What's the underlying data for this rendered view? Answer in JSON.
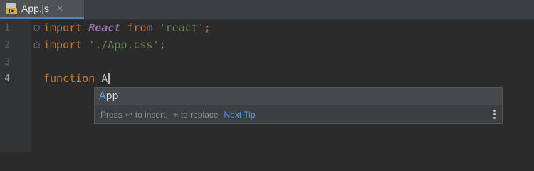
{
  "tabs": [
    {
      "label": "App.js",
      "icon_text": "JS",
      "close_glyph": "✕",
      "icon": "javascript-file-icon"
    }
  ],
  "gutter": {
    "line_numbers": [
      "1",
      "2",
      "3",
      "4"
    ],
    "active_line": "4"
  },
  "code": {
    "line1": {
      "kw_import": "import",
      "class_name": "React",
      "kw_from": "from",
      "string": "'react'",
      "semi": ";"
    },
    "line2": {
      "kw_import": "import",
      "string": "'./App.css'",
      "semi": ";"
    },
    "line4": {
      "kw_function": "function",
      "typed": "A"
    }
  },
  "completion": {
    "item_match": "A",
    "item_rest": "pp",
    "hint_press": "Press",
    "hint_insert_key": "↩",
    "hint_insert": "to insert,",
    "hint_replace_key": "⇥",
    "hint_replace": "to replace",
    "next_tip": "Next Tip",
    "more_icon": "vertical-ellipsis-icon"
  },
  "colors": {
    "editor_bg": "#2b2b2b",
    "keyword": "#cc7832",
    "string": "#6a8759",
    "class": "#9876aa",
    "accent": "#589df6"
  }
}
